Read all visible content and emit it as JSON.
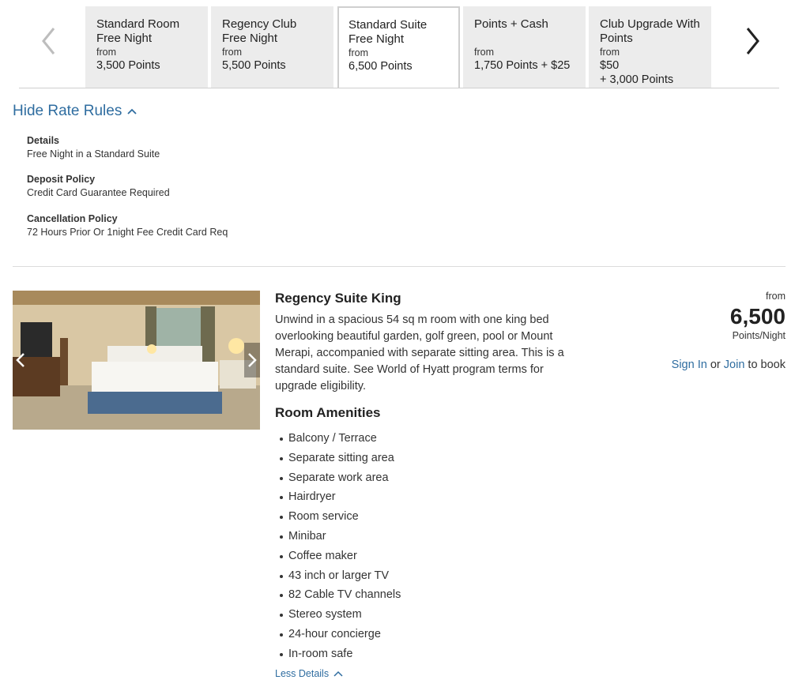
{
  "tabs": [
    {
      "title": "Standard Room Free Night",
      "from": "from",
      "price": "3,500 Points",
      "active": false
    },
    {
      "title": "Regency Club Free Night",
      "from": "from",
      "price": "5,500 Points",
      "active": false
    },
    {
      "title": "Standard Suite Free Night",
      "from": "from",
      "price": "6,500 Points",
      "active": true
    },
    {
      "title": "Points + Cash",
      "from": "from",
      "price": "1,750 Points + $25",
      "active": false
    },
    {
      "title": "Club Upgrade With Points",
      "from": "from",
      "price": "$50",
      "price2": "+ 3,000 Points",
      "active": false
    }
  ],
  "rules": {
    "toggle_label": "Hide Rate Rules",
    "details_label": "Details",
    "details_value": "Free Night in a Standard Suite",
    "deposit_label": "Deposit Policy",
    "deposit_value": "Credit Card Guarantee Required",
    "cancel_label": "Cancellation Policy",
    "cancel_value": "72 Hours Prior Or 1night Fee Credit Card Req"
  },
  "room": {
    "title": "Regency Suite King",
    "description": "Unwind in a spacious 54 sq m room with one king bed overlooking beautiful garden, golf green, pool or Mount Merapi, accompanied with separate sitting area. This is a standard suite. See World of Hyatt program terms for upgrade eligibility.",
    "amenities_title": "Room Amenities",
    "amenities": [
      "Balcony / Terrace",
      "Separate sitting area",
      "Separate work area",
      "Hairdryer",
      "Room service",
      "Minibar",
      "Coffee maker",
      "43 inch or larger TV",
      "82 Cable TV channels",
      "Stereo system",
      "24-hour concierge",
      "In-room safe"
    ],
    "less_details": "Less Details"
  },
  "price": {
    "from": "from",
    "value": "6,500",
    "unit": "Points/Night",
    "sign_in": "Sign In",
    "or": "or",
    "join": "Join",
    "to_book": "to book"
  },
  "colors": {
    "link": "#2f6da0",
    "tab_bg": "#ececec",
    "divider": "#dcdcdc"
  }
}
